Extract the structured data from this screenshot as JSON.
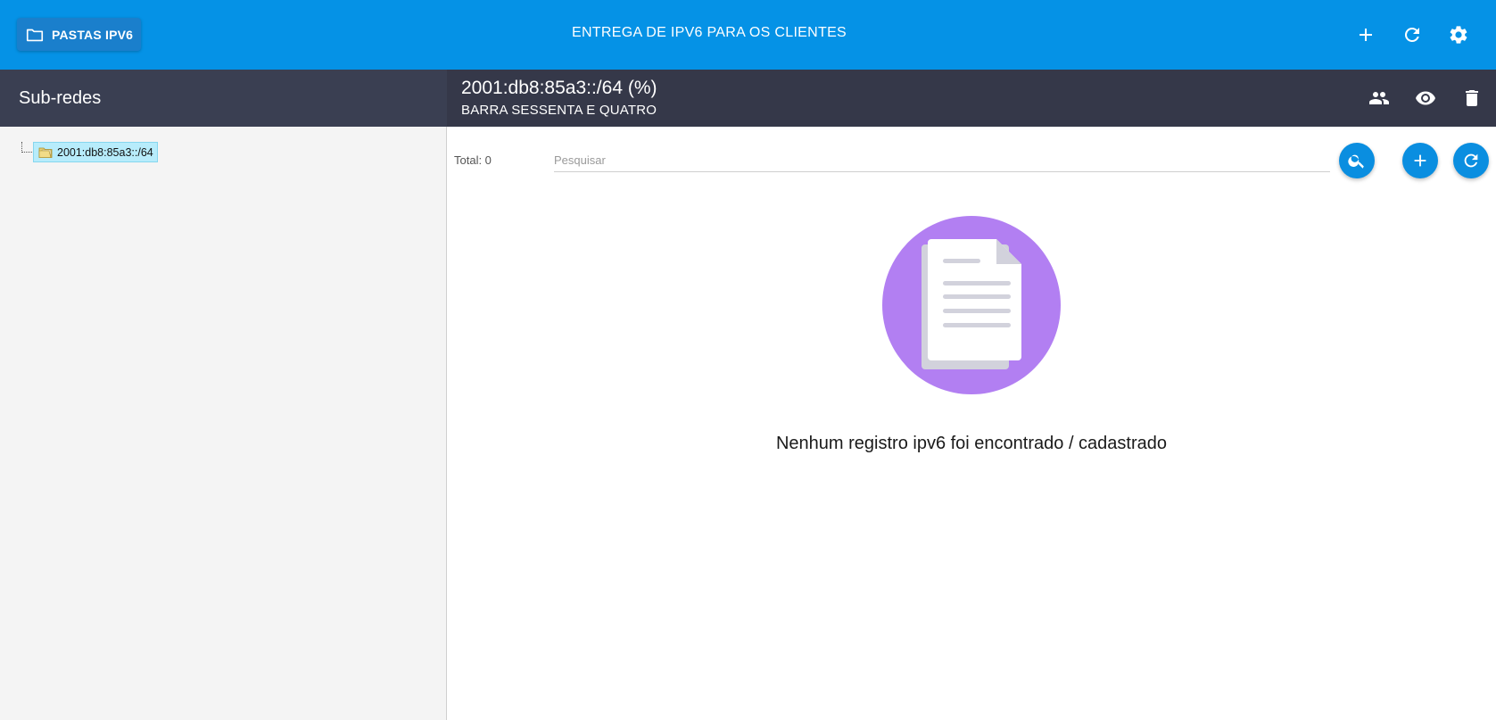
{
  "topbar": {
    "folders_button_label": "PASTAS IPV6",
    "title": "ENTREGA DE IPV6 PARA OS CLIENTES",
    "actions": [
      {
        "name": "add",
        "icon": "plus-icon"
      },
      {
        "name": "refresh",
        "icon": "refresh-icon"
      },
      {
        "name": "settings",
        "icon": "gear-icon"
      }
    ]
  },
  "sidebar": {
    "title": "Sub-redes",
    "tree": [
      {
        "label": "2001:db8:85a3::/64",
        "icon": "folder-icon",
        "selected": true
      }
    ]
  },
  "detail": {
    "subnet": "2001:db8:85a3::/64 (%)",
    "description": "BARRA SESSENTA E QUATRO",
    "actions": [
      {
        "name": "users",
        "icon": "people-icon"
      },
      {
        "name": "view",
        "icon": "eye-icon"
      },
      {
        "name": "delete",
        "icon": "trash-icon"
      }
    ]
  },
  "list": {
    "total_label": "Total: 0",
    "search_placeholder": "Pesquisar",
    "search_value": "",
    "empty_message": "Nenhum registro ipv6 foi encontrado / cadastrado"
  },
  "colors": {
    "topbar": "#0592e6",
    "left_header": "#3a3f52",
    "right_header": "#353849",
    "fab": "#0a8ee0",
    "empty_circle": "#b27ff2",
    "tree_selected": "#b7ecfb"
  }
}
